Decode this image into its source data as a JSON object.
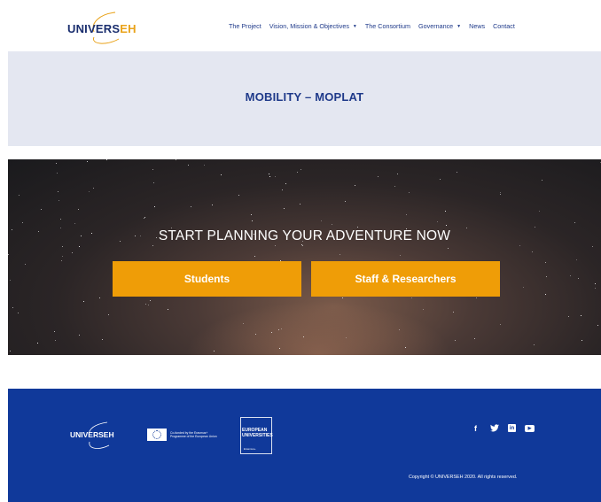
{
  "header": {
    "logo_main": "UNIVERS",
    "logo_accent": "EH",
    "nav": [
      {
        "label": "The Project",
        "has_caret": false
      },
      {
        "label": "Vision, Mission & Objectives",
        "has_caret": true
      },
      {
        "label": "The Consortium",
        "has_caret": false
      },
      {
        "label": "Governance",
        "has_caret": true
      },
      {
        "label": "News",
        "has_caret": false
      },
      {
        "label": "Contact",
        "has_caret": false
      }
    ],
    "caret_symbol": "▼"
  },
  "title_band": {
    "title": "MOBILITY – MOPLAT"
  },
  "hero": {
    "heading": "START PLANNING YOUR ADVENTURE NOW",
    "buttons": {
      "students": "Students",
      "staff": "Staff & Researchers"
    }
  },
  "footer": {
    "logo": "UNIVERSEH",
    "eu_cofunded": "Co-funded by the Erasmus+ Programme of the European Union",
    "eu_universities": "EUROPEAN UNIVERSITIES",
    "eu_universities_sub": "Erasmus+",
    "social_icons": [
      "facebook-icon",
      "twitter-icon",
      "linkedin-icon",
      "youtube-icon"
    ],
    "social_glyphs": {
      "facebook": "f",
      "twitter": "🐦",
      "linkedin": "in",
      "youtube": "▶"
    },
    "copyright": "Copyright © UNIVERSEH 2020. All rights reserved."
  },
  "colors": {
    "brand_blue": "#1f3a8a",
    "accent_orange": "#ef9d07",
    "footer_blue": "#10399a",
    "band_bg": "#e4e7f1"
  }
}
